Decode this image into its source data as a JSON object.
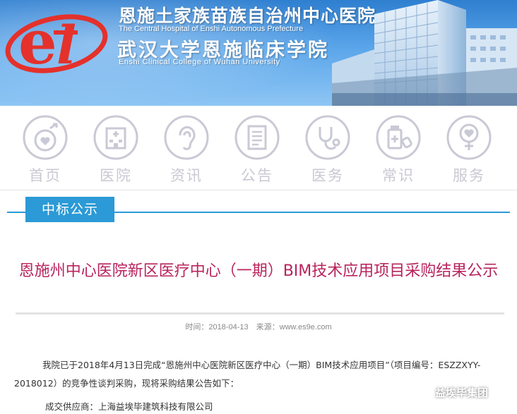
{
  "banner": {
    "logo_name": "e-logo",
    "cn_name": "恩施土家族苗族自治州中心医院",
    "en_name": "The Central Hospital of Enshi Autonomous Prefecture",
    "college_cn": "武汉大学恩施临床学院",
    "college_en": "Enshi Clinical College of Wuhan University",
    "colors": {
      "primary": "#3a8ad9",
      "logo_red": "#e4312b"
    }
  },
  "nav": {
    "items": [
      {
        "label": "首页",
        "icon": "home-heart-icon"
      },
      {
        "label": "医院",
        "icon": "hospital-building-icon"
      },
      {
        "label": "资讯",
        "icon": "ear-icon"
      },
      {
        "label": "公告",
        "icon": "document-icon"
      },
      {
        "label": "医务",
        "icon": "stethoscope-icon"
      },
      {
        "label": "常识",
        "icon": "medicine-bottle-icon"
      },
      {
        "label": "服务",
        "icon": "heart-person-icon"
      }
    ]
  },
  "section": {
    "tab_label": "中标公示",
    "color": "#2b9ad6"
  },
  "article": {
    "title": "恩施州中心医院新区医疗中心（一期）BIM技术应用项目采购结果公示",
    "time_label": "时间：2018-04-13",
    "source_label": "来源：www.es9e.com",
    "paragraph": "我院已于2018年4月13日完成“恩施州中心医院新区医疗中心（一期）BIM技术应用项目”（项目编号：ESZZXYY-2018012）的竞争性谈判采购，现将采购结果公告如下：",
    "supplier": "成交供应商：上海益埃毕建筑科技有限公司",
    "title_color": "#b8245c"
  },
  "watermark": {
    "text": "益埃毕集团",
    "icon": "wechat-icon"
  }
}
